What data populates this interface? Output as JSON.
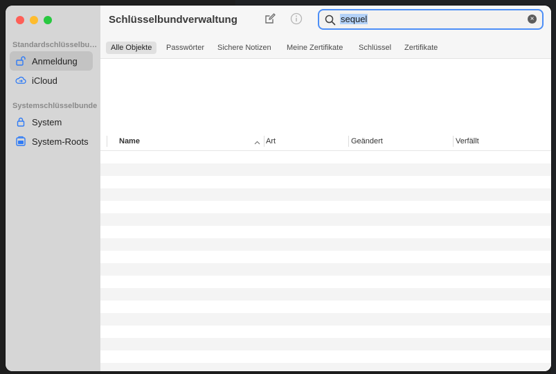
{
  "app": {
    "title": "Schlüsselbundverwaltung"
  },
  "sidebar": {
    "sections": [
      {
        "label": "Standardschlüsselbunde",
        "items": [
          {
            "label": "Anmeldung",
            "icon": "lock-open-icon",
            "selected": true
          },
          {
            "label": "iCloud",
            "icon": "cloud-icon",
            "selected": false
          }
        ]
      },
      {
        "label": "Systemschlüsselbunde",
        "items": [
          {
            "label": "System",
            "icon": "lock-icon",
            "selected": false
          },
          {
            "label": "System-Roots",
            "icon": "cabinet-icon",
            "selected": false
          }
        ]
      }
    ]
  },
  "toolbar": {
    "new_item_icon": "compose-icon",
    "info_icon": "info-icon"
  },
  "search": {
    "value": "sequel"
  },
  "tabs": [
    {
      "label": "Alle Objekte",
      "active": true
    },
    {
      "label": "Passwörter",
      "active": false
    },
    {
      "label": "Sichere Notizen",
      "active": false
    },
    {
      "label": "Meine Zertifikate",
      "active": false
    },
    {
      "label": "Schlüssel",
      "active": false
    },
    {
      "label": "Zertifikate",
      "active": false
    }
  ],
  "table": {
    "columns": [
      "Name",
      "Art",
      "Geändert",
      "Verfällt"
    ],
    "rows": []
  },
  "colors": {
    "accent": "#4c8ef7",
    "sidebar_bg": "#d6d6d6",
    "icon_blue": "#2f7bf6"
  }
}
